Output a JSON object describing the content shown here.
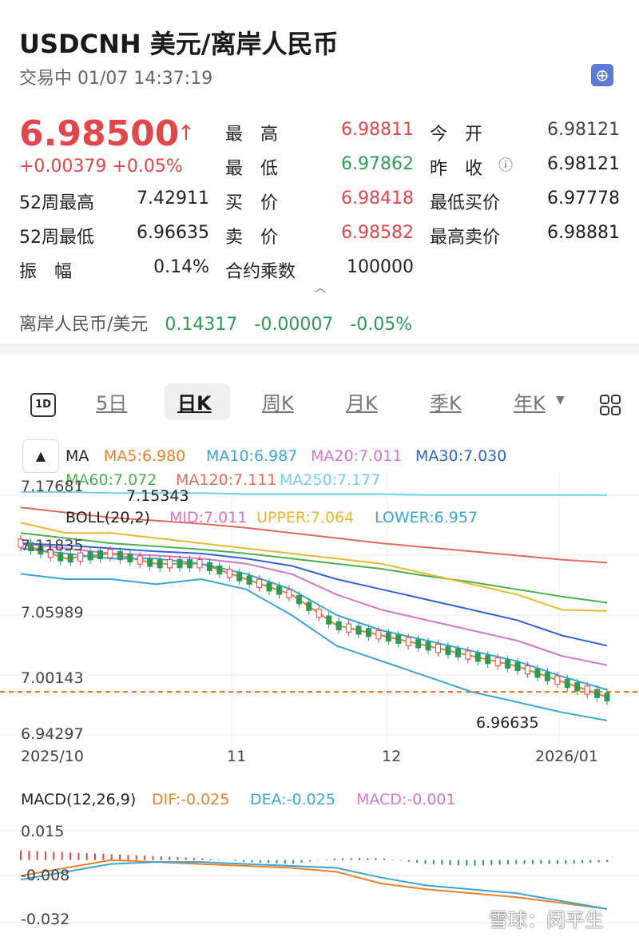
{
  "header": {
    "title": "USDCNH   美元/离岸人民币",
    "subtitle": "交易中 01/07 14:37:19",
    "price": "6.98500",
    "price_arrow": "↑",
    "change": "+0.00379 +0.05%"
  },
  "quote": {
    "high_label": "最　高",
    "high": "6.98811",
    "open_label": "今　开",
    "open": "6.98121",
    "low_label": "最　低",
    "low": "6.97862",
    "prev_label": "昨　收",
    "prev": "6.98121",
    "w52h_label": "52周最高",
    "w52h": "7.42911",
    "bid_label": "买　价",
    "bid": "6.98418",
    "minbid_label": "最低买价",
    "minbid": "6.97778",
    "w52l_label": "52周最低",
    "w52l": "6.96635",
    "ask_label": "卖　价",
    "ask": "6.98582",
    "maxask_label": "最高卖价",
    "maxask": "6.98881",
    "amp_label": "振　幅",
    "amp": "0.14%",
    "mult_label": "合约乘数",
    "mult": "100000"
  },
  "reverse": {
    "label": "离岸人民币/美元",
    "value": "0.14317",
    "change": "-0.00007",
    "pct": "-0.05%"
  },
  "tabs": {
    "d1": "1D",
    "items": [
      "5日",
      "日K",
      "周K",
      "月K",
      "季K",
      "年K"
    ]
  },
  "indicators": {
    "ma": "MA",
    "ma5": "MA5:6.980",
    "ma10": "MA10:6.987",
    "ma20": "MA20:7.011",
    "ma30": "MA30:7.030",
    "ma60": "MA60:7.072",
    "ma120": "MA120:7.111",
    "ma250": "MA250:7.177",
    "boll": "BOLL(20,2)",
    "mid": "MID:7.011",
    "upper": "UPPER:7.064",
    "lower": "LOWER:6.957"
  },
  "colors": {
    "ma5": "#e8822a",
    "ma10": "#3ba4d9",
    "ma20": "#d874c9",
    "ma30": "#2f63d6",
    "ma60": "#4caf50",
    "ma120": "#e06a5c",
    "ma250": "#6fd0e8",
    "upper": "#e8b930",
    "lower": "#3ba4d9",
    "candle_up": "#e0464a",
    "candle_down": "#2f9a57",
    "dif": "#e8822a",
    "dea": "#3ba4d9",
    "macd": "#d874c9"
  },
  "main_axis": {
    "y_labels": [
      "7.17681",
      "7.11835",
      "7.05989",
      "7.00143",
      "6.94297"
    ],
    "x_labels": [
      "2025/10",
      "11",
      "12",
      "2026/01"
    ],
    "high_mark": "7.15343",
    "low_mark": "6.96635"
  },
  "macd": {
    "label": "MACD(12,26,9)",
    "dif": "DIF:-0.025",
    "dea": "DEA:-0.025",
    "macd": "MACD:-0.001",
    "y_labels": [
      "0.015",
      "-0.008",
      "-0.032"
    ]
  },
  "watermark": "雪球：闵平生",
  "chart_data": [
    {
      "type": "line",
      "title": "",
      "x": [
        "2025/10",
        "11",
        "12",
        "2026/01"
      ],
      "ylim": [
        6.94297,
        7.17681
      ],
      "last_price": 6.985,
      "series": [
        {
          "name": "MA5",
          "values": [
            7.13,
            7.115,
            7.12,
            7.11,
            7.11,
            7.095,
            7.08,
            7.05,
            7.04,
            7.03,
            7.02,
            7.01,
            6.995,
            6.98
          ]
        },
        {
          "name": "MA10",
          "values": [
            7.125,
            7.12,
            7.115,
            7.115,
            7.11,
            7.1,
            7.085,
            7.06,
            7.045,
            7.035,
            7.025,
            7.015,
            7.0,
            6.987
          ]
        },
        {
          "name": "MA20",
          "values": [
            7.13,
            7.125,
            7.12,
            7.118,
            7.115,
            7.11,
            7.1,
            7.08,
            7.065,
            7.055,
            7.045,
            7.035,
            7.02,
            7.011
          ]
        },
        {
          "name": "MA30",
          "values": [
            7.13,
            7.128,
            7.125,
            7.122,
            7.12,
            7.115,
            7.108,
            7.095,
            7.085,
            7.075,
            7.065,
            7.055,
            7.04,
            7.03
          ]
        },
        {
          "name": "MA60",
          "values": [
            7.14,
            7.135,
            7.13,
            7.127,
            7.124,
            7.12,
            7.115,
            7.11,
            7.105,
            7.098,
            7.092,
            7.085,
            7.078,
            7.072
          ]
        },
        {
          "name": "MA120",
          "values": [
            7.165,
            7.16,
            7.155,
            7.152,
            7.149,
            7.145,
            7.14,
            7.135,
            7.13,
            7.126,
            7.122,
            7.118,
            7.114,
            7.111
          ]
        },
        {
          "name": "MA250",
          "values": [
            7.18,
            7.18,
            7.179,
            7.179,
            7.179,
            7.178,
            7.178,
            7.178,
            7.178,
            7.177,
            7.177,
            7.177,
            7.177,
            7.177
          ]
        },
        {
          "name": "UPPER",
          "values": [
            7.15,
            7.14,
            7.14,
            7.135,
            7.13,
            7.125,
            7.12,
            7.115,
            7.11,
            7.1,
            7.09,
            7.08,
            7.065,
            7.064
          ]
        },
        {
          "name": "LOWER",
          "values": [
            7.1,
            7.095,
            7.095,
            7.09,
            7.095,
            7.085,
            7.06,
            7.03,
            7.015,
            7.0,
            6.985,
            6.975,
            6.965,
            6.957
          ]
        }
      ]
    },
    {
      "type": "bar",
      "title": "",
      "ylim": [
        -0.032,
        0.015
      ],
      "series": [
        {
          "name": "MACD",
          "values": [
            0.005,
            0.004,
            0.003,
            0.002,
            0.001,
            -0.001,
            -0.002,
            0.001,
            0.001,
            -0.002,
            -0.003,
            -0.002,
            -0.002,
            -0.001
          ]
        },
        {
          "name": "DIF",
          "values": [
            -0.008,
            -0.004,
            0.0,
            -0.001,
            -0.002,
            -0.003,
            -0.004,
            -0.006,
            -0.012,
            -0.015,
            -0.017,
            -0.019,
            -0.022,
            -0.025
          ]
        },
        {
          "name": "DEA",
          "values": [
            -0.01,
            -0.006,
            -0.002,
            -0.001,
            -0.001,
            -0.002,
            -0.003,
            -0.004,
            -0.009,
            -0.013,
            -0.015,
            -0.017,
            -0.021,
            -0.025
          ]
        }
      ]
    }
  ]
}
